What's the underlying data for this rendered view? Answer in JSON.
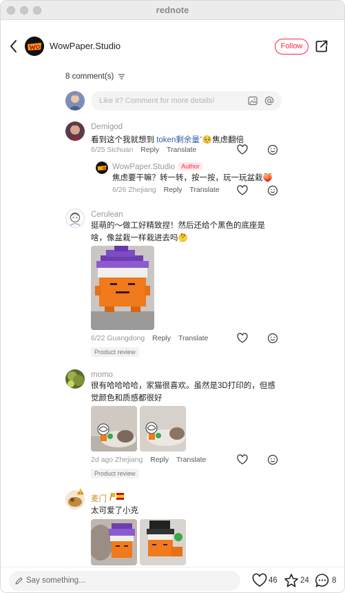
{
  "window": {
    "title": "rednote"
  },
  "header": {
    "account_name": "WowPaper.Studio",
    "follow_label": "Follow"
  },
  "comments_header": {
    "count_label": "8 comment(s)",
    "input_placeholder": "Like it? Comment for more details!"
  },
  "comments": [
    {
      "name": "Demigod",
      "text_prefix": "看到这个我就想到 ",
      "text_link": "token剩余量",
      "text_suffix": "焦虑翻倍",
      "emoji": "🥺",
      "date_location": "6/25 Sichuan",
      "reply_label": "Reply",
      "translate_label": "Translate"
    },
    {
      "name": "WowPaper.Studio",
      "badge": "Author",
      "text": "焦虑要干嘛？转一转，按一按，玩一玩盆栽",
      "emoji": "🍑",
      "date_location": "6/26 Zhejiang",
      "reply_label": "Reply",
      "translate_label": "Translate"
    },
    {
      "name": "Cerulean",
      "text": "挺萌的～做工好精致捏！然后还给个黑色的底座是啥，像盆栽一样栽进去吗",
      "emoji": "🤔",
      "date_location": "6/22 Guangdong",
      "reply_label": "Reply",
      "translate_label": "Translate",
      "tag": "Product review"
    },
    {
      "name": "momo",
      "text": "很有哈哈哈哈，家猫很喜欢。虽然是3D打印的，但感觉颜色和质感都很好",
      "date_location": "2d ago Zhejiang",
      "reply_label": "Reply",
      "translate_label": "Translate",
      "tag": "Product review"
    },
    {
      "name": "麦门",
      "text": "太可爱了小克"
    }
  ],
  "bottom_bar": {
    "placeholder": "Say something...",
    "likes": "46",
    "collects": "24",
    "comments": "8"
  },
  "colors": {
    "accent": "#ff2442",
    "link": "#2e5ba8",
    "muted": "#999999"
  }
}
